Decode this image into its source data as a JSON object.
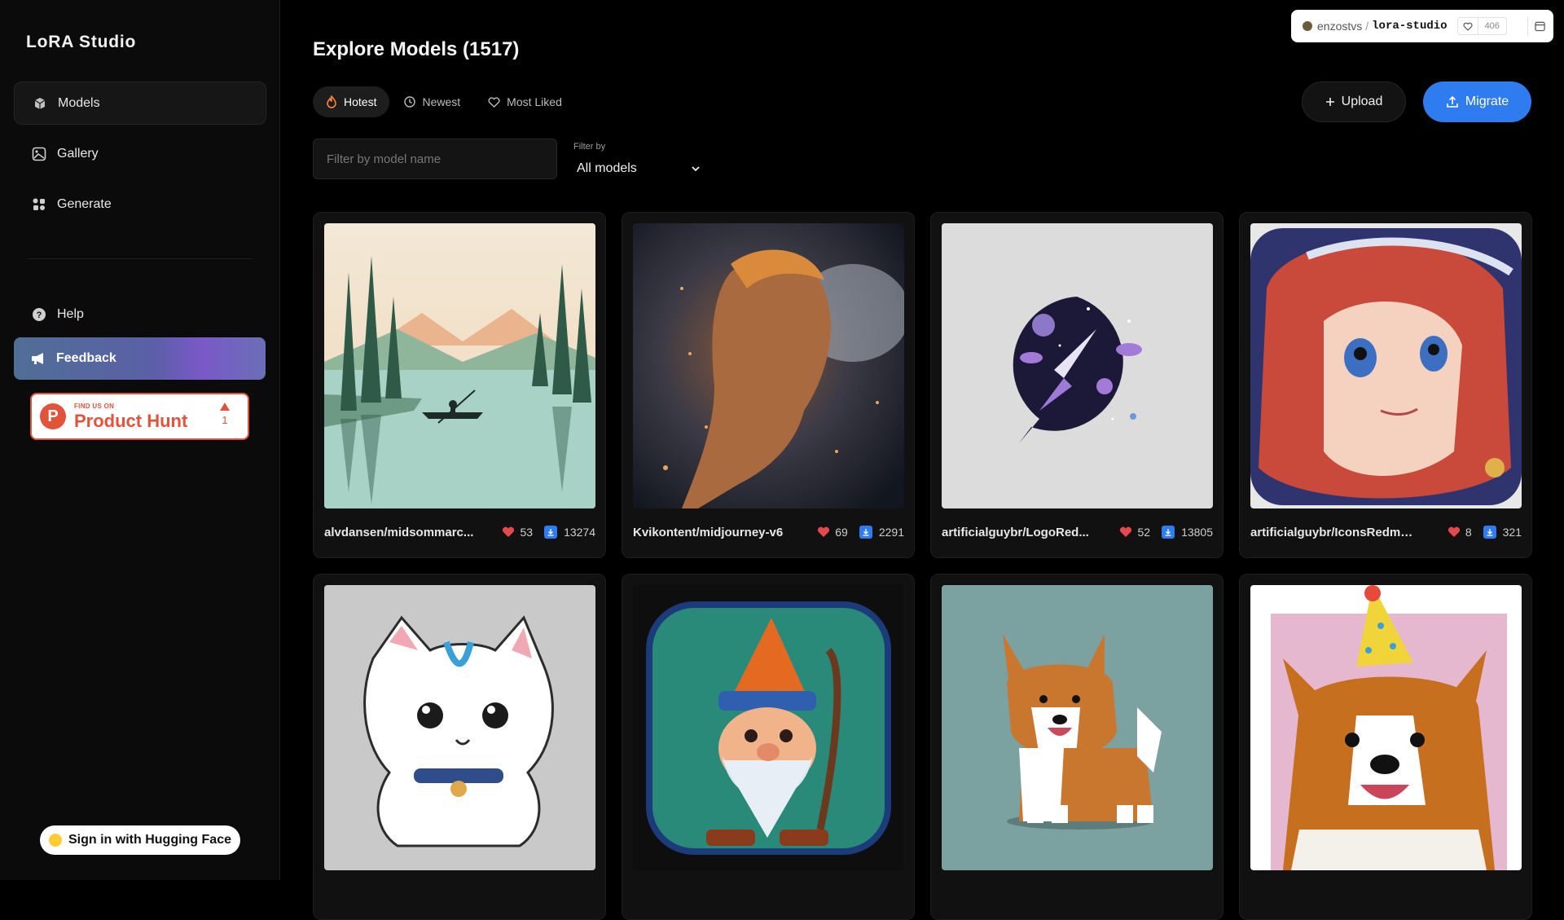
{
  "app": {
    "brand": "LoRA Studio"
  },
  "sidebar": {
    "items": [
      {
        "label": "Models",
        "icon": "cube-icon"
      },
      {
        "label": "Gallery",
        "icon": "image-icon"
      },
      {
        "label": "Generate",
        "icon": "sparkles-icon"
      }
    ],
    "help": "Help",
    "feedback": "Feedback",
    "product_hunt": {
      "small": "FIND US ON",
      "big": "Product Hunt",
      "votes": "1"
    },
    "signin": "Sign in with Hugging Face"
  },
  "hf_badge": {
    "owner": "enzostvs",
    "sep": "/",
    "repo": "lora-studio",
    "likes": "406"
  },
  "main": {
    "title": "Explore Models (1517)",
    "tabs": [
      {
        "label": "Hotest",
        "icon": "flame-icon"
      },
      {
        "label": "Newest",
        "icon": "clock-icon"
      },
      {
        "label": "Most Liked",
        "icon": "heart-icon"
      }
    ],
    "upload": "Upload",
    "migrate": "Migrate",
    "search_placeholder": "Filter by model name",
    "filter_label": "Filter by",
    "filter_value": "All models"
  },
  "cards": [
    {
      "name": "alvdansen/midsommarc...",
      "likes": "53",
      "downloads": "13274",
      "theme": "lake"
    },
    {
      "name": "Kvikontent/midjourney-v6",
      "likes": "69",
      "downloads": "2291",
      "theme": "portrait"
    },
    {
      "name": "artificialguybr/LogoRed...",
      "likes": "52",
      "downloads": "13805",
      "theme": "rocket"
    },
    {
      "name": "artificialguybr/IconsRedmo...",
      "likes": "8",
      "downloads": "321",
      "theme": "anime"
    },
    {
      "name": "",
      "likes": "",
      "downloads": "",
      "theme": "cat"
    },
    {
      "name": "",
      "likes": "",
      "downloads": "",
      "theme": "gnome"
    },
    {
      "name": "",
      "likes": "",
      "downloads": "",
      "theme": "corgi"
    },
    {
      "name": "",
      "likes": "",
      "downloads": "",
      "theme": "corgi-party"
    }
  ],
  "colors": {
    "accent": "#2f7cf0",
    "heart": "#e5484d",
    "product_hunt": "#e2533b"
  }
}
